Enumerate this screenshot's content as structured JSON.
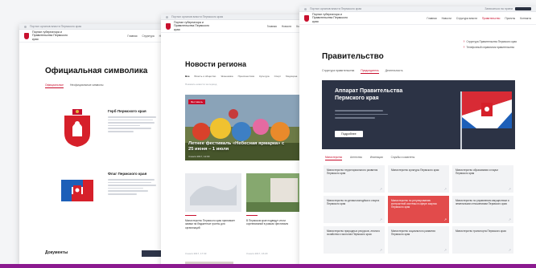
{
  "left": {
    "topbar": "Портал органов власти Пермского края",
    "org": "Портал губернатора и Правительства Пермского края",
    "nav": [
      "Главная",
      "Структура",
      "Новости"
    ],
    "title": "Официальная символика",
    "tabs": [
      "Официальные",
      "Неофициальные символы"
    ],
    "symbols": [
      {
        "title": "Герб Пермского края"
      },
      {
        "title": "Флаг Пермского края"
      }
    ],
    "docs": "Документы"
  },
  "mid": {
    "topbar": "Портал органов власти Пермского края",
    "org": "Портал губернатора и Правительства Пермского края",
    "nav": [
      "Главная",
      "Новости",
      "Контакты"
    ],
    "title": "Новости региона",
    "tabs": [
      "Все",
      "Власть и общество",
      "Экономика",
      "Происшествия",
      "Культура",
      "Спорт",
      "Медицина"
    ],
    "sub": "Показать новости за период",
    "hero": {
      "tag": "Фестиваль",
      "title": "Летнее фестиваль «Небесная ярмарка» с 25 июня – 1 июля",
      "date": "4 июля 2017, 12:00"
    },
    "cards": [
      {
        "text": "Министерство Пермского края принимает заявки на бюджетные гранты для организаций",
        "date": "3 июля 2017, 17:33"
      },
      {
        "text": "В Пермском крае подведут итоги соревнований в рамках фестиваля",
        "date": "3 июля 2017, 16:20"
      }
    ]
  },
  "right": {
    "topbar": "Портал органов власти Пермского края",
    "login": "Записаться на прием",
    "org": "Портал губернатора и Правительства Пермского края",
    "nav": [
      "Главная",
      "Новости",
      "Структура власти",
      "Правительство",
      "Проекты",
      "Контакты"
    ],
    "title": "Правительство",
    "tabs": [
      "Структура правительства",
      "Председатель",
      "Деятельность"
    ],
    "right_links": [
      "Структура Правительства Пермского края",
      "Телефонный справочник правительства"
    ],
    "banner": {
      "title": "Аппарат Правительства Пермского края",
      "button": "Подробнее"
    },
    "dept_tabs": [
      "Министерства",
      "Агентства",
      "Инспекции",
      "Службы и комитеты"
    ],
    "cells": [
      {
        "text": "Министерство территориального развития Пермского края",
        "highlight": false
      },
      {
        "text": "Министерство культуры Пермского края",
        "highlight": false
      },
      {
        "text": "Министерство образования и науки Пермского края",
        "highlight": false
      },
      {
        "text": "Министерство по делам молодёжи и спорта Пермского края",
        "highlight": false
      },
      {
        "text": "Министерство по регулированию контрактной системы в сфере закупок Пермского края",
        "highlight": true
      },
      {
        "text": "Министерство по управлению имуществом и земельными отношениями Пермского края",
        "highlight": false
      },
      {
        "text": "Министерство природных ресурсов, лесного хозяйства и экологии Пермского края",
        "highlight": false
      },
      {
        "text": "Министерство социального развития Пермского края",
        "highlight": false
      },
      {
        "text": "Министерство транспорта Пермского края",
        "highlight": false
      }
    ]
  },
  "colors": {
    "accent": "#c8102e",
    "dark": "#2c3345",
    "highlight": "#e24b4b"
  }
}
